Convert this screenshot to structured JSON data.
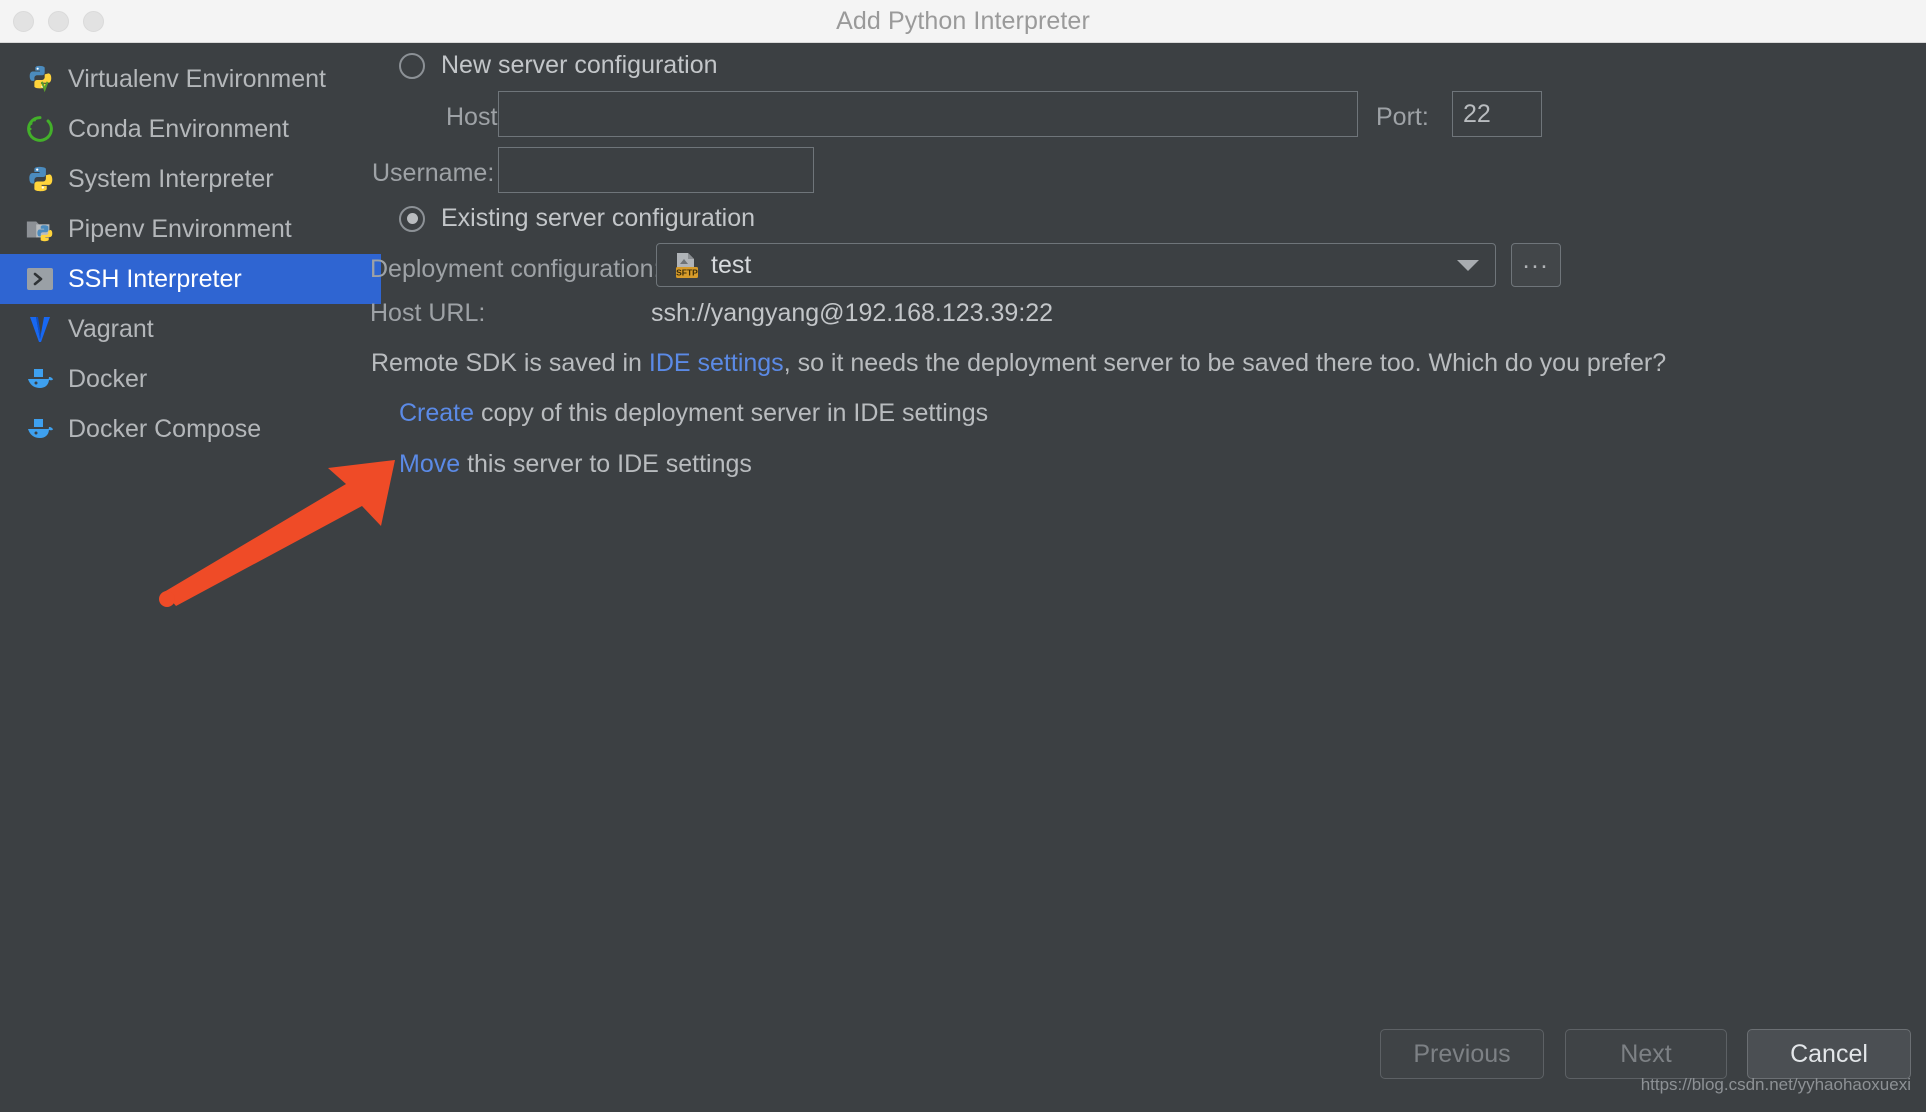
{
  "window": {
    "title": "Add Python Interpreter",
    "traffic_lights": [
      "close-button",
      "minimize-button",
      "zoom-button"
    ]
  },
  "sidebar": {
    "items": [
      {
        "label": "Virtualenv Environment",
        "icon": "python-venv-icon",
        "selected": false
      },
      {
        "label": "Conda Environment",
        "icon": "conda-icon",
        "selected": false
      },
      {
        "label": "System Interpreter",
        "icon": "python-icon",
        "selected": false
      },
      {
        "label": "Pipenv Environment",
        "icon": "pipenv-icon",
        "selected": false
      },
      {
        "label": "SSH Interpreter",
        "icon": "ssh-terminal-icon",
        "selected": true
      },
      {
        "label": "Vagrant",
        "icon": "vagrant-icon",
        "selected": false
      },
      {
        "label": "Docker",
        "icon": "docker-icon",
        "selected": false
      },
      {
        "label": "Docker Compose",
        "icon": "docker-compose-icon",
        "selected": false
      }
    ]
  },
  "main": {
    "new_server": {
      "radio_label": "New server configuration",
      "checked": false,
      "host_label": "Host:",
      "host_value": "",
      "host_placeholder": "",
      "port_label": "Port:",
      "port_value": "22",
      "username_label": "Username:",
      "username_value": "",
      "username_placeholder": ""
    },
    "existing_server": {
      "radio_label": "Existing server configuration",
      "checked": true,
      "deployment_label": "Deployment configuration:",
      "deployment_value": "test",
      "deployment_icon": "sftp-icon",
      "browse_label": "...",
      "host_url_label": "Host URL:",
      "host_url_value": "ssh://yangyang@192.168.123.39:22"
    },
    "notice": {
      "prefix": "Remote SDK is saved in ",
      "link": "IDE settings",
      "suffix": ", so it needs the deployment server to be saved there too. Which do you prefer?"
    },
    "choices": [
      {
        "link": "Create",
        "text": " copy of this deployment server in IDE settings"
      },
      {
        "link": "Move",
        "text": " this server to IDE settings"
      }
    ]
  },
  "footer": {
    "buttons": [
      {
        "label": "Previous",
        "enabled": false
      },
      {
        "label": "Next",
        "enabled": false
      },
      {
        "label": "Cancel",
        "enabled": true
      }
    ],
    "watermark": "https://blog.csdn.net/yyhaohaoxuexi"
  },
  "annotation": {
    "type": "arrow",
    "color": "#ef4b27",
    "points_to": "move-link"
  },
  "colors": {
    "window_bg": "#3c4043",
    "titlebar_bg": "#f4f4f4",
    "selection_blue": "#2f65d2",
    "link_blue": "#5b8ae6",
    "text": "#b9bcbf",
    "annotation_red": "#ef4b27"
  }
}
